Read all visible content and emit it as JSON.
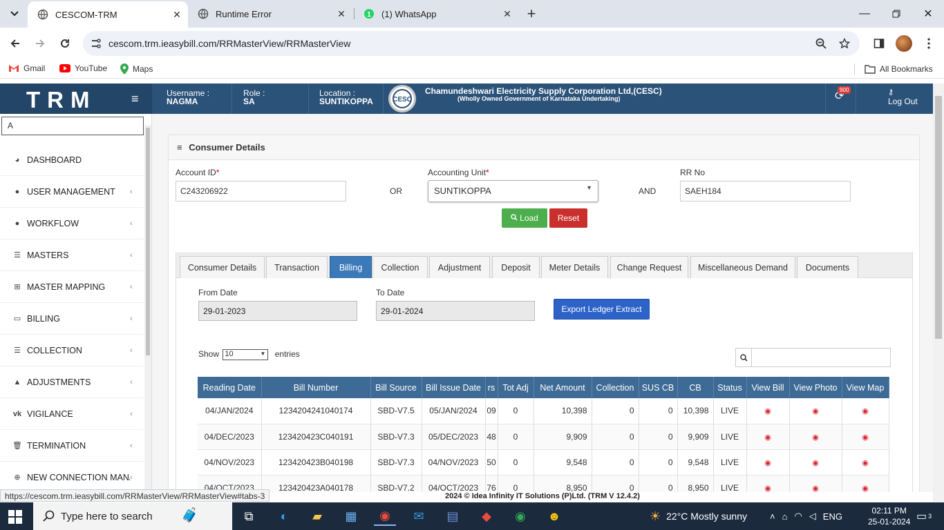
{
  "browser": {
    "tabs": [
      {
        "title": "CESCOM-TRM",
        "active": true
      },
      {
        "title": "Runtime Error",
        "active": false
      },
      {
        "title": "(1) WhatsApp",
        "active": false
      }
    ],
    "url": "cescom.trm.ieasybill.com/RRMasterView/RRMasterView",
    "bookmarks": [
      "Gmail",
      "YouTube",
      "Maps"
    ],
    "all_bookmarks": "All Bookmarks",
    "status_url": "https://cescom.trm.ieasybill.com/RRMasterView/RRMasterView#tabs-3"
  },
  "header": {
    "logo": "TRM",
    "username_label": "Username :",
    "username": "NAGMA",
    "role_label": "Role :",
    "role": "SA",
    "location_label": "Location :",
    "location": "SUNTIKOPPA",
    "org_name": "Chamundeshwari Electricity Supply Corporation Ltd,(CESC)",
    "org_sub": "(Wholly Owned Government of Karnataka Undertaking)",
    "notification_count": "900",
    "logout": "Log Out"
  },
  "sidebar": {
    "search_value": "A",
    "items": [
      {
        "label": "DASHBOARD",
        "icon": "dashboard-icon",
        "chevron": false
      },
      {
        "label": "USER MANAGEMENT",
        "icon": "user-icon",
        "chevron": true
      },
      {
        "label": "WORKFLOW",
        "icon": "user-icon",
        "chevron": true
      },
      {
        "label": "MASTERS",
        "icon": "list-icon",
        "chevron": true
      },
      {
        "label": "MASTER MAPPING",
        "icon": "sitemap-icon",
        "chevron": true
      },
      {
        "label": "BILLING",
        "icon": "desktop-icon",
        "chevron": true
      },
      {
        "label": "COLLECTION",
        "icon": "list-icon",
        "chevron": true
      },
      {
        "label": "ADJUSTMENTS",
        "icon": "adjust-icon",
        "chevron": true
      },
      {
        "label": "VIGILANCE",
        "icon": "vk-icon",
        "chevron": true
      },
      {
        "label": "TERMINATION",
        "icon": "trash-icon",
        "chevron": true
      },
      {
        "label": "NEW CONNECTION MANA...",
        "icon": "plus-circle-icon",
        "chevron": true
      }
    ]
  },
  "consumer": {
    "panel_title": "Consumer Details",
    "account_id_label": "Account ID",
    "account_id": "C243206922",
    "or": "OR",
    "accounting_unit_label": "Accounting Unit",
    "accounting_unit": "SUNTIKOPPA",
    "and": "AND",
    "rr_no_label": "RR No",
    "rr_no": "SAEH184",
    "load": "Load",
    "reset": "Reset"
  },
  "tabs": [
    "Consumer Details",
    "Transaction",
    "Billing",
    "Collection",
    "Adjustment",
    "Deposit",
    "Meter Details",
    "Change Request",
    "Miscellaneous Demand",
    "Documents"
  ],
  "active_tab": "Billing",
  "billing": {
    "from_date_label": "From Date",
    "from_date": "29-01-2023",
    "to_date_label": "To Date",
    "to_date": "29-01-2024",
    "export_label": "Export Ledger Extract",
    "show_label": "Show",
    "entries_value": "10",
    "entries_label": "entries"
  },
  "table": {
    "columns": [
      "Reading Date",
      "Bill Number",
      "Bill Source",
      "Bill Issue Date",
      "rs",
      "Tot Adj",
      "Net Amount",
      "Collection",
      "SUS CB",
      "CB",
      "Status",
      "View Bill",
      "View Photo",
      "View Map"
    ],
    "rows": [
      [
        "04/JAN/2024",
        "1234204241040174",
        "SBD-V7.5",
        "05/JAN/2024",
        "09",
        "0",
        "10,398",
        "0",
        "0",
        "10,398",
        "LIVE"
      ],
      [
        "04/DEC/2023",
        "123420423C040191",
        "SBD-V7.3",
        "05/DEC/2023",
        "48",
        "0",
        "9,909",
        "0",
        "0",
        "9,909",
        "LIVE"
      ],
      [
        "04/NOV/2023",
        "123420423B040198",
        "SBD-V7.3",
        "04/NOV/2023",
        "50",
        "0",
        "9,548",
        "0",
        "0",
        "9,548",
        "LIVE"
      ],
      [
        "04/OCT/2023",
        "123420423A040178",
        "SBD-V7.2",
        "04/OCT/2023",
        "76",
        "0",
        "8,950",
        "0",
        "0",
        "8,950",
        "LIVE"
      ]
    ]
  },
  "footer": "2024 © Idea Infinity IT Solutions (P)Ltd. (TRM V 12.4.2)",
  "taskbar": {
    "search_placeholder": "Type here to search",
    "weather": "22°C  Mostly sunny",
    "lang": "ENG",
    "time": "02:11 PM",
    "date": "25-01-2024",
    "notifications": "3"
  },
  "colors": {
    "header": "#2b5279",
    "table_header": "#3e6b96",
    "active_tab": "#3c79b8",
    "load": "#4cae4c",
    "reset": "#c9302c",
    "export": "#2d63c8"
  }
}
